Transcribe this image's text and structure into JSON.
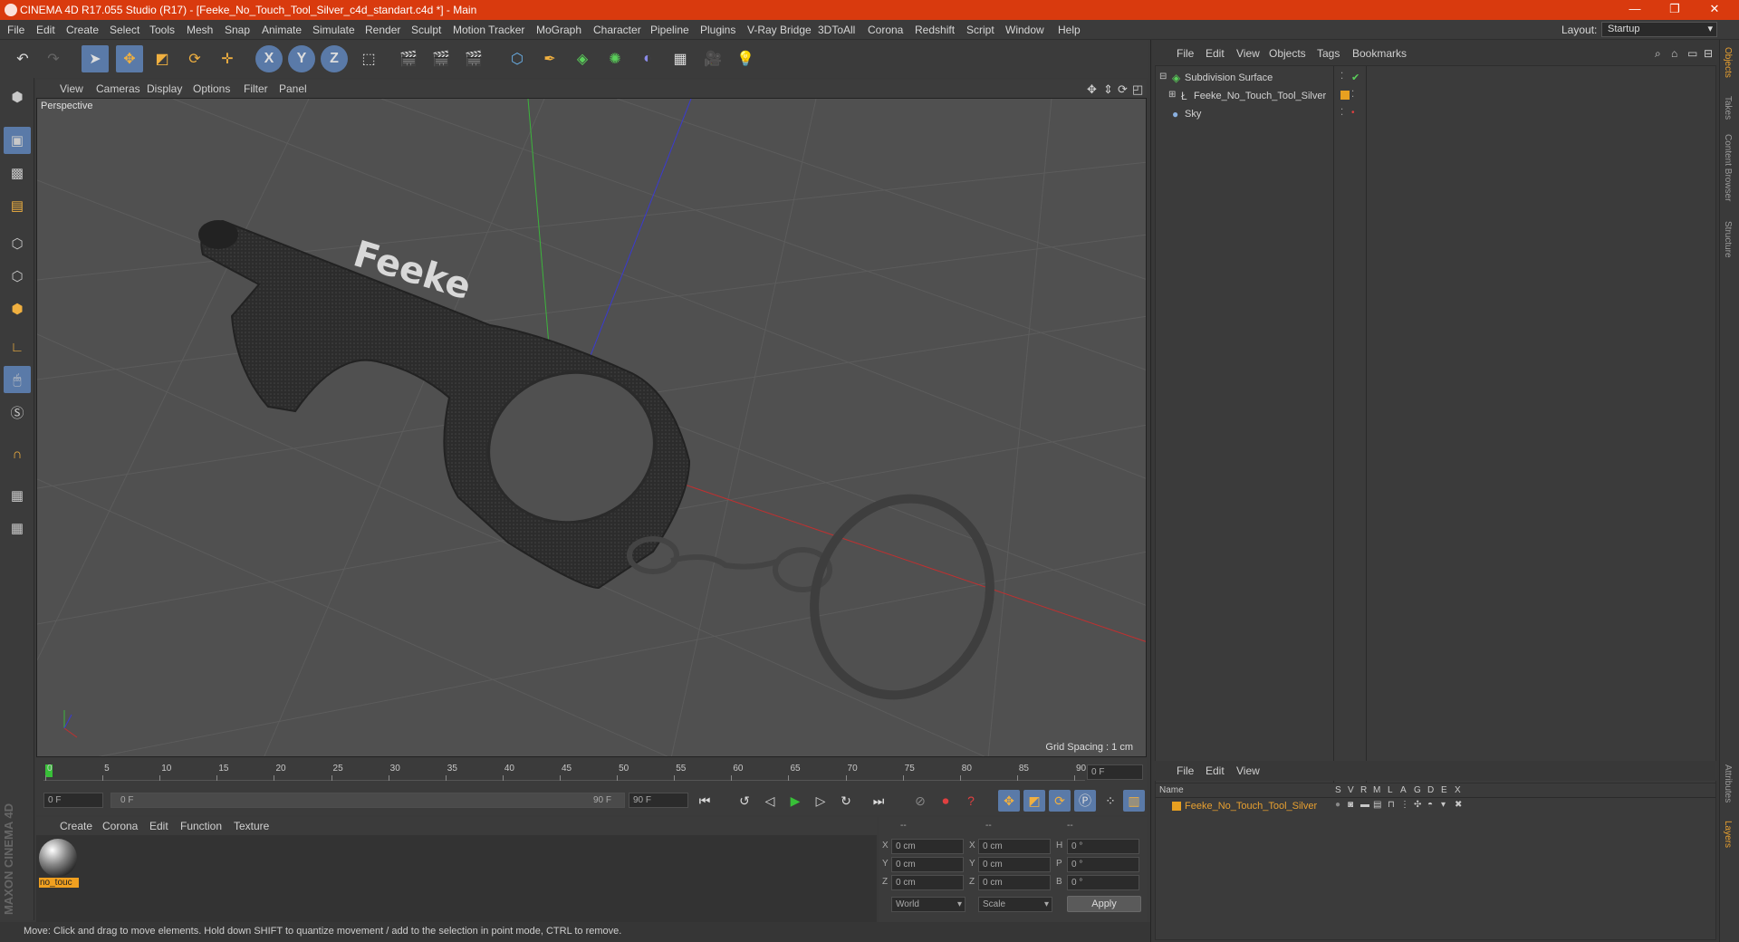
{
  "window": {
    "title": "CINEMA 4D R17.055 Studio (R17) - [Feeke_No_Touch_Tool_Silver_c4d_standart.c4d *] - Main",
    "controls": {
      "minimize": "—",
      "maximize": "❐",
      "close": "✕"
    }
  },
  "menu": {
    "items": [
      "File",
      "Edit",
      "Create",
      "Select",
      "Tools",
      "Mesh",
      "Snap",
      "Animate",
      "Simulate",
      "Render",
      "Sculpt",
      "Motion Tracker",
      "MoGraph",
      "Character",
      "Pipeline",
      "Plugins",
      "V-Ray Bridge",
      "3DToAll",
      "Corona",
      "Redshift",
      "Script",
      "Window",
      "Help"
    ],
    "layout_label": "Layout:",
    "layout_value": "Startup"
  },
  "toolbar": {
    "axis_x": "X",
    "axis_y": "Y",
    "axis_z": "Z"
  },
  "viewport": {
    "menu": [
      "View",
      "Cameras",
      "Display",
      "Options",
      "Filter",
      "Panel"
    ],
    "label": "Perspective",
    "grid_spacing": "Grid Spacing : 1 cm",
    "model_text": "Feeke"
  },
  "timeline": {
    "ticks": [
      "0",
      "5",
      "10",
      "15",
      "20",
      "25",
      "30",
      "35",
      "40",
      "45",
      "50",
      "55",
      "60",
      "65",
      "70",
      "75",
      "80",
      "85",
      "90"
    ],
    "current_frame": "0 F",
    "start_field": "0 F",
    "range_start": "0 F",
    "range_end": "90 F",
    "end_field": "90 F"
  },
  "materials": {
    "menu": [
      "Create",
      "Corona",
      "Edit",
      "Function",
      "Texture"
    ],
    "items": [
      {
        "name": "no_touc"
      }
    ]
  },
  "coordinates": {
    "headers": [
      "--",
      "--",
      "--"
    ],
    "rows": [
      {
        "axis1": "X",
        "val1": "0 cm",
        "axis2": "X",
        "val2": "0 cm",
        "axis3": "H",
        "val3": "0 °"
      },
      {
        "axis1": "Y",
        "val1": "0 cm",
        "axis2": "Y",
        "val2": "0 cm",
        "axis3": "P",
        "val3": "0 °"
      },
      {
        "axis1": "Z",
        "val1": "0 cm",
        "axis2": "Z",
        "val2": "0 cm",
        "axis3": "B",
        "val3": "0 °"
      }
    ],
    "space": "World",
    "mode": "Scale",
    "apply": "Apply"
  },
  "status": "Move: Click and drag to move elements. Hold down SHIFT to quantize movement / add to the selection in point mode, CTRL to remove.",
  "objects": {
    "menu": [
      "File",
      "Edit",
      "View",
      "Objects",
      "Tags",
      "Bookmarks"
    ],
    "items": [
      {
        "name": "Subdivision Surface"
      },
      {
        "name": "Feeke_No_Touch_Tool_Silver"
      },
      {
        "name": "Sky"
      }
    ]
  },
  "layers": {
    "menu": [
      "File",
      "Edit",
      "View"
    ],
    "columns": [
      "Name",
      "S",
      "V",
      "R",
      "M",
      "L",
      "A",
      "G",
      "D",
      "E",
      "X"
    ],
    "row_name": "Feeke_No_Touch_Tool_Silver"
  },
  "side_tabs": [
    "Objects",
    "Takes",
    "Content Browser",
    "Structure",
    "Attributes",
    "Layers"
  ],
  "brand": "MAXON CINEMA 4D",
  "colors": {
    "title_bar": "#d93a0e",
    "accent": "#e8a030",
    "selected_tool": "#5a7aa8"
  }
}
